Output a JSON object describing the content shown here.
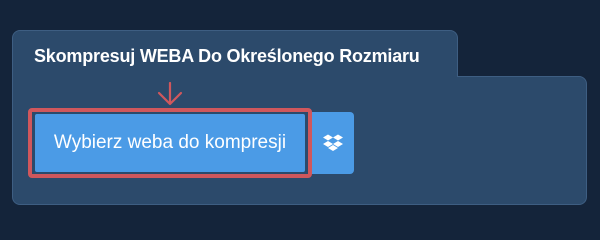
{
  "panel": {
    "title": "Skompresuj WEBA Do Określonego Rozmiaru"
  },
  "upload_button": {
    "label": "Wybierz weba do kompresji"
  },
  "icons": {
    "arrow": "arrow-down-icon",
    "dropbox": "dropbox-icon"
  },
  "colors": {
    "background": "#14243a",
    "panel": "#2c4a6b",
    "button": "#4b9be6",
    "highlight": "#d0575c"
  }
}
